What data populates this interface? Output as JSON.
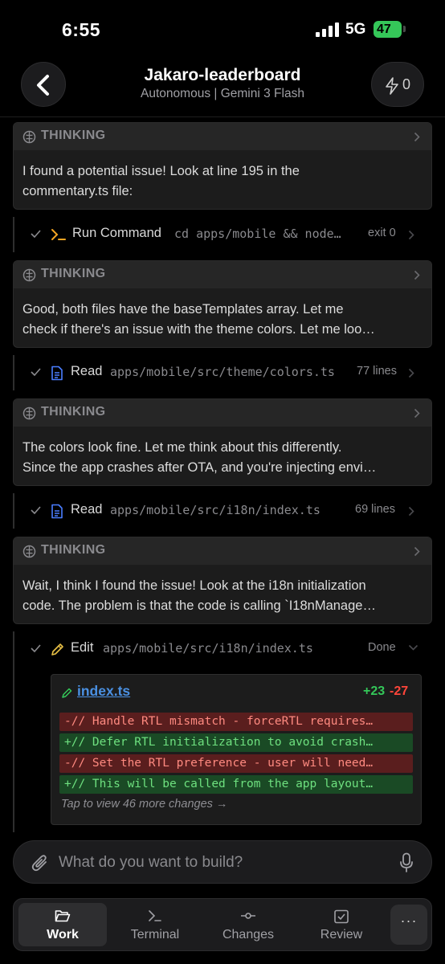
{
  "status_bar": {
    "time": "6:55",
    "network": "5G",
    "battery": "47"
  },
  "header": {
    "title": "Jakaro-leaderboard",
    "subtitle": "Autonomous | Gemini 3 Flash",
    "credits": "0"
  },
  "feed": {
    "thinking_label": "THINKING",
    "thinking_1": {
      "line1": "I found a potential issue! Look at line 195 in the",
      "line2": "commentary.ts file:"
    },
    "tool_run": {
      "name": "Run Command",
      "arg": "cd apps/mobile && node…",
      "result": "exit 0"
    },
    "thinking_2": {
      "line1": "Good, both files have the baseTemplates array. Let me",
      "line2": "check if there's an issue with the theme colors. Let me loo…"
    },
    "tool_read_1": {
      "name": "Read",
      "arg": "apps/mobile/src/theme/colors.ts",
      "result": "77 lines"
    },
    "thinking_3": {
      "line1": "The colors look fine. Let me think about this differently.",
      "line2": "Since the app crashes after OTA, and you're injecting envi…"
    },
    "tool_read_2": {
      "name": "Read",
      "arg": "apps/mobile/src/i18n/index.ts",
      "result": "69 lines"
    },
    "thinking_4": {
      "line1": "Wait, I think I found the issue! Look at the i18n initialization",
      "line2": "code. The problem is that the code is calling `I18nManage…"
    },
    "tool_edit": {
      "name": "Edit",
      "arg": "apps/mobile/src/i18n/index.ts",
      "result": "Done"
    },
    "diff": {
      "file": "index.ts",
      "additions": "+23",
      "deletions": "-27",
      "lines": [
        "-// Handle RTL mismatch - forceRTL requires…",
        "+// Defer RTL initialization to avoid crash…",
        "-// Set the RTL preference - user will need…",
        "+// This will be called from the app layout…"
      ],
      "more": "Tap to view 46 more changes →"
    }
  },
  "composer": {
    "placeholder": "What do you want to build?"
  },
  "nav": {
    "work": "Work",
    "terminal": "Terminal",
    "changes": "Changes",
    "review": "Review",
    "more": "···"
  },
  "colors": {
    "background": "#000000",
    "card": "#1c1c1c",
    "link": "#4a90e2",
    "added": "#34c759",
    "removed": "#ff453a",
    "terminal_accent": "#f5a623",
    "read_icon": "#4a7dff",
    "edit_icon": "#e8c046"
  }
}
